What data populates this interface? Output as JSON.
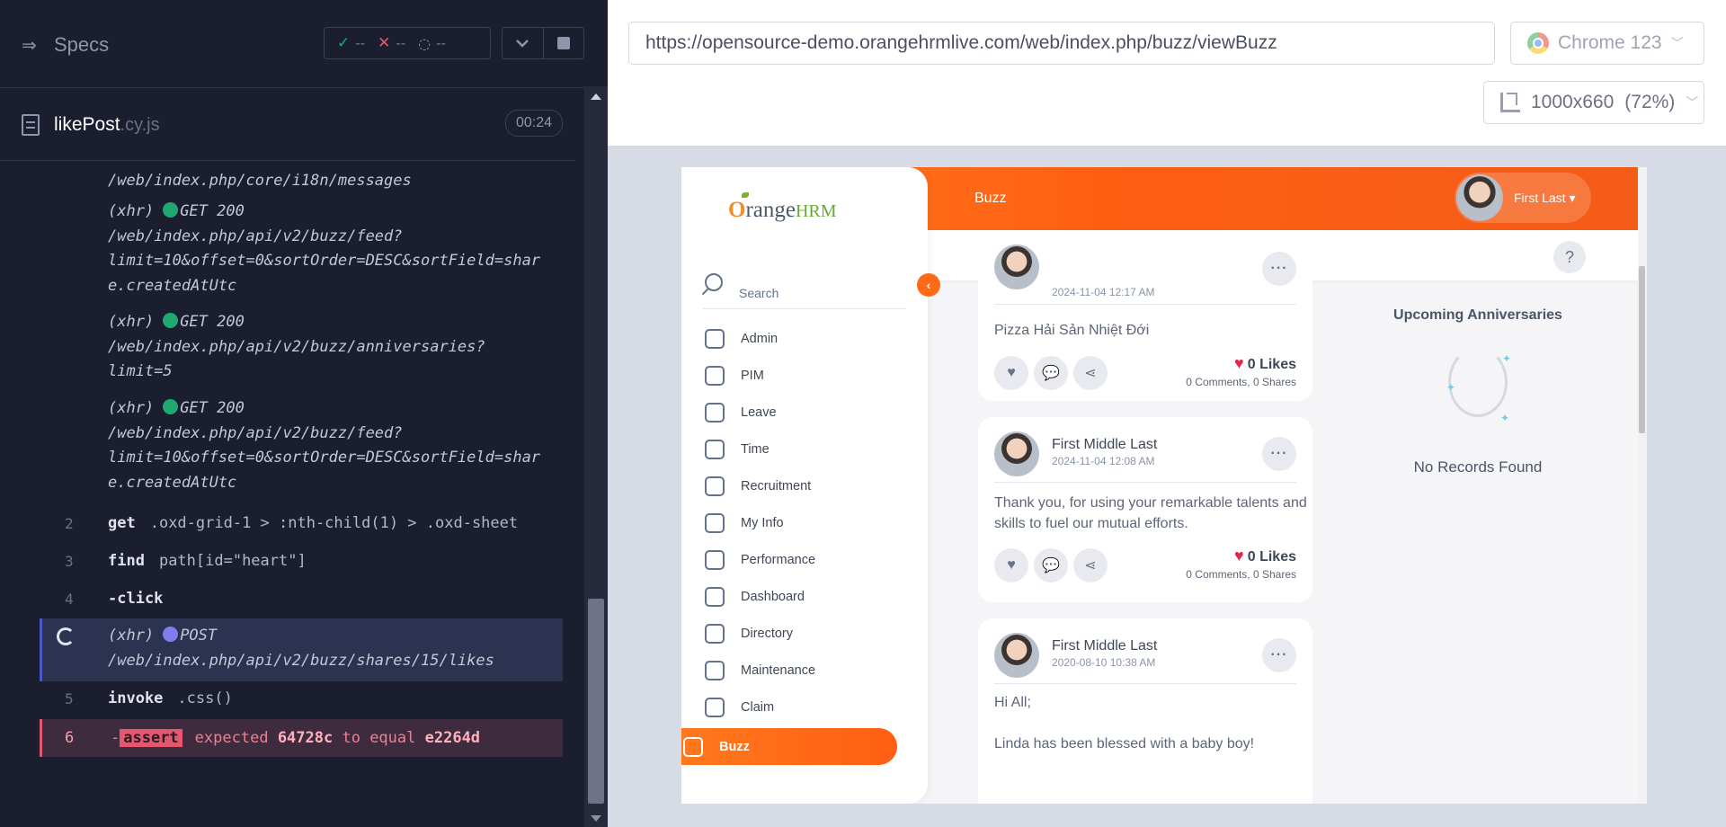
{
  "reporter": {
    "specs_label": "Specs",
    "stats": {
      "passed": "--",
      "failed": "--",
      "pending": "--"
    },
    "spec_file": {
      "name": "likePost",
      "ext": ".cy.js"
    },
    "timer": "00:24",
    "log": {
      "top_partial_url": "/web/index.php/core/i18n/messages",
      "xhr1": {
        "label": "(xhr)",
        "method_status": "GET 200",
        "url_lines": [
          "/web/index.php/api/v2/buzz/feed?",
          "limit=10&offset=0&sortOrder=DESC&sortField=shar",
          "e.createdAtUtc"
        ]
      },
      "xhr2": {
        "label": "(xhr)",
        "method_status": "GET 200",
        "url_lines": [
          "/web/index.php/api/v2/buzz/anniversaries?",
          "limit=5"
        ]
      },
      "xhr3": {
        "label": "(xhr)",
        "method_status": "GET 200",
        "url_lines": [
          "/web/index.php/api/v2/buzz/feed?",
          "limit=10&offset=0&sortOrder=DESC&sortField=shar",
          "e.createdAtUtc"
        ]
      },
      "commands": [
        {
          "num": "2",
          "name": "get",
          "message": ".oxd-grid-1 > :nth-child(1) > .oxd-sheet"
        },
        {
          "num": "3",
          "name": "find",
          "message": "path[id=\"heart\"]"
        },
        {
          "num": "4",
          "name": "-click",
          "message": ""
        }
      ],
      "pending_xhr": {
        "label": "(xhr)",
        "method": "POST",
        "url": "/web/index.php/api/v2/buzz/shares/15/likes"
      },
      "invoke": {
        "num": "5",
        "name": "invoke",
        "message": ".css()"
      },
      "assert": {
        "num": "6",
        "prefix": "-",
        "tag": "assert",
        "text_expected": "expected",
        "actual": "64728c",
        "text_to_equal": "to equal",
        "expected": "e2264d"
      }
    }
  },
  "browser": {
    "url": "https://opensource-demo.orangehrmlive.com/web/index.php/buzz/viewBuzz",
    "browser_name": "Chrome 123",
    "viewport": "1000x660",
    "zoom": "(72%)"
  },
  "app": {
    "logo": {
      "o": "O",
      "range": "range",
      "hrm": "HRM"
    },
    "topbar_title": "Buzz",
    "user_name": "First Last ▾",
    "help": "?",
    "search_label": "Search",
    "nav": [
      "Admin",
      "PIM",
      "Leave",
      "Time",
      "Recruitment",
      "My Info",
      "Performance",
      "Dashboard",
      "Directory",
      "Maintenance",
      "Claim"
    ],
    "nav_active": "Buzz",
    "posts": [
      {
        "date": "2024-11-04 12:17 AM",
        "text": "Pizza Hải Sản Nhiệt Đới",
        "likes": "0 Likes",
        "stats": "0 Comments, 0 Shares"
      },
      {
        "name": "First Middle Last",
        "date": "2024-11-04 12:08 AM",
        "text": "Thank you, for using your remarkable talents and skills to fuel our mutual efforts.",
        "likes": "0 Likes",
        "stats": "0 Comments, 0 Shares"
      },
      {
        "name": "First Middle Last",
        "date": "2020-08-10 10:38 AM",
        "text_line1": "Hi All;",
        "text_line2": "Linda has been blessed with a baby boy!"
      }
    ],
    "widget": {
      "title": "Upcoming Anniversaries",
      "empty_text": "No Records Found"
    }
  },
  "colors": {
    "brand_orange": "#ff7b1d",
    "like_red": "#e2264d",
    "pass_green": "#1fa971",
    "fail_red": "#e45770"
  }
}
